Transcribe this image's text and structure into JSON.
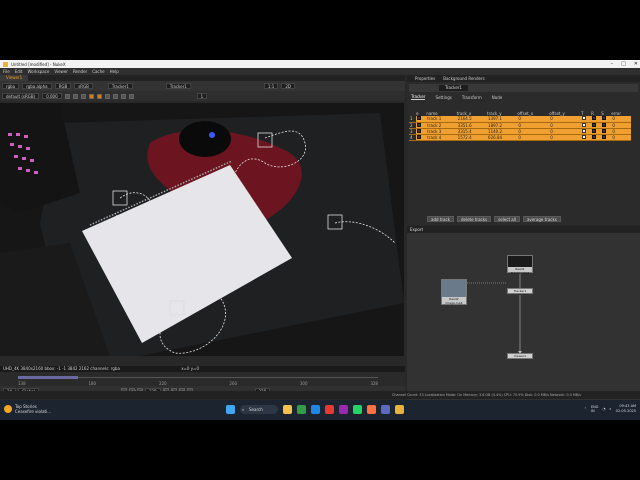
{
  "window": {
    "title": "Untitled [modified] - NukeX",
    "controls": [
      "–",
      "□",
      "✕"
    ]
  },
  "menu": [
    "File",
    "Edit",
    "Workspace",
    "Viewer",
    "Render",
    "Cache",
    "Help"
  ],
  "viewer": {
    "tab": "Viewer1",
    "toolbar1": {
      "channels": "rgba",
      "alpha": "rgba.alpha",
      "colorspace": "RGB",
      "proxy": "sRGB",
      "node_a": "Tracker1",
      "node_b": "Tracker1",
      "gain": "1.8",
      "f": "f/8",
      "zoom": "1:1",
      "mode": "2D"
    },
    "toolbar2": {
      "lut": "default (sRGB)",
      "y": "y",
      "gamma": "0.000",
      "value": "1"
    },
    "info": "UHD_4K 3840x2160  bbox: -1 -1 3842 2162 channels: rgba",
    "coords": "x=0 y=0"
  },
  "timeline": {
    "ticks": [
      "138",
      "180",
      "220",
      "260",
      "300",
      "328"
    ]
  },
  "playbar": {
    "frame": "138",
    "fps": "24",
    "mode": "Global",
    "end": "328"
  },
  "properties": {
    "tabs": [
      "Properties",
      "Background Renders"
    ],
    "node": "Tracker1",
    "subtabs": [
      "Tracker",
      "Settings",
      "Transform",
      "Node"
    ],
    "columns": [
      "",
      "e",
      "name",
      "track_x",
      "track_y",
      "offset_x",
      "offset_y",
      "T",
      "R",
      "S",
      "error"
    ],
    "tracks": [
      {
        "idx": "1",
        "name": "track 1",
        "tx": "2164.5",
        "ty": "1397.1",
        "ox": "0",
        "oy": "0",
        "err": "0"
      },
      {
        "idx": "2",
        "name": "track 2",
        "tx": "3351.6",
        "ty": "1897.2",
        "ox": "0",
        "oy": "0",
        "err": "0"
      },
      {
        "idx": "3",
        "name": "track 3",
        "tx": "3315.4",
        "ty": "1140.2",
        "ox": "0",
        "oy": "0",
        "err": "0"
      },
      {
        "idx": "4",
        "name": "track 4",
        "tx": "1572.4",
        "ty": "626.84",
        "ox": "0",
        "oy": "0",
        "err": "0"
      }
    ],
    "buttons": [
      "add track",
      "delete tracks",
      "select all",
      "average tracks"
    ]
  },
  "dag": {
    "title": "Export",
    "nodes": [
      {
        "label": "Read2\nimage.mp4"
      },
      {
        "label": "Read1\nTracker.mp4"
      },
      {
        "label": "Tracker1"
      },
      {
        "label": "Viewer1"
      }
    ]
  },
  "status": "Channel Count: 33  Localization Mode: On  Memory: 3.6 GB (4.4%)  CPU: 70.9%  Disk: 0.0 MB/s  Network: 0.0 MB/s",
  "taskbar": {
    "weather_title": "Top Stories",
    "weather_sub": "Ceasefire violati...",
    "search": "Search",
    "lang": "ENG\nIN",
    "time": "09:43 AM",
    "date": "02-05-2025"
  }
}
